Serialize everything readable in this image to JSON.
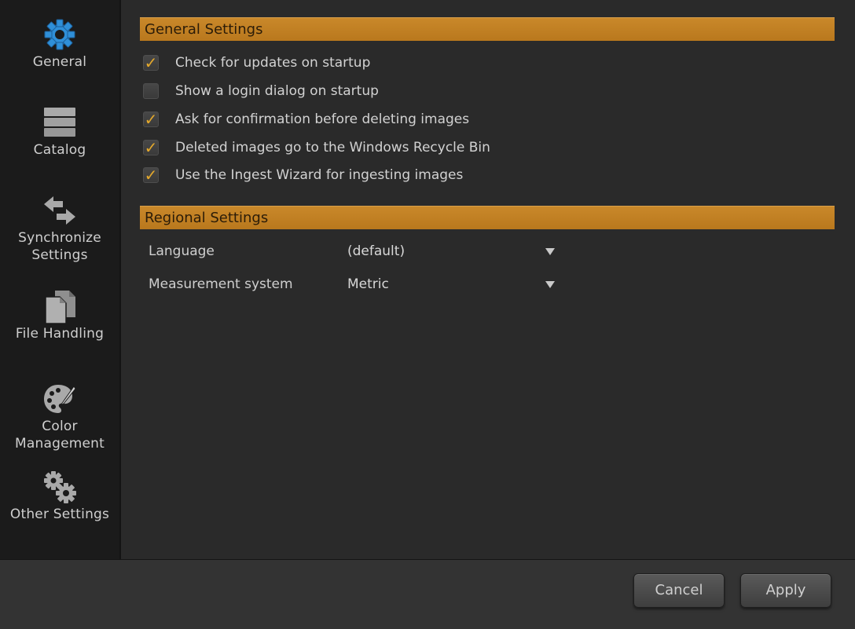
{
  "sidebar": {
    "items": [
      {
        "id": "general",
        "label": "General",
        "icon": "gear-icon"
      },
      {
        "id": "catalog",
        "label": "Catalog",
        "icon": "catalog-stack-icon"
      },
      {
        "id": "synchronize",
        "label": "Synchronize Settings",
        "icon": "sync-arrows-icon"
      },
      {
        "id": "file-handling",
        "label": "File Handling",
        "icon": "files-icon"
      },
      {
        "id": "color-management",
        "label": "Color Management",
        "icon": "palette-icon"
      },
      {
        "id": "other-settings",
        "label": "Other Settings",
        "icon": "gears-icon"
      }
    ]
  },
  "general": {
    "header": "General Settings",
    "options": [
      {
        "label": "Check for updates on startup",
        "checked": true
      },
      {
        "label": "Show a login dialog on startup",
        "checked": false
      },
      {
        "label": "Ask for confirmation before deleting images",
        "checked": true
      },
      {
        "label": "Deleted images go to the Windows Recycle Bin",
        "checked": true
      },
      {
        "label": "Use the Ingest Wizard for ingesting images",
        "checked": true
      }
    ]
  },
  "regional": {
    "header": "Regional Settings",
    "language_label": "Language",
    "language_value": "(default)",
    "measurement_label": "Measurement system",
    "measurement_value": "Metric"
  },
  "footer": {
    "cancel_label": "Cancel",
    "apply_label": "Apply"
  },
  "colors": {
    "accent": "#e3a82c",
    "header_bar": "#c08025"
  }
}
